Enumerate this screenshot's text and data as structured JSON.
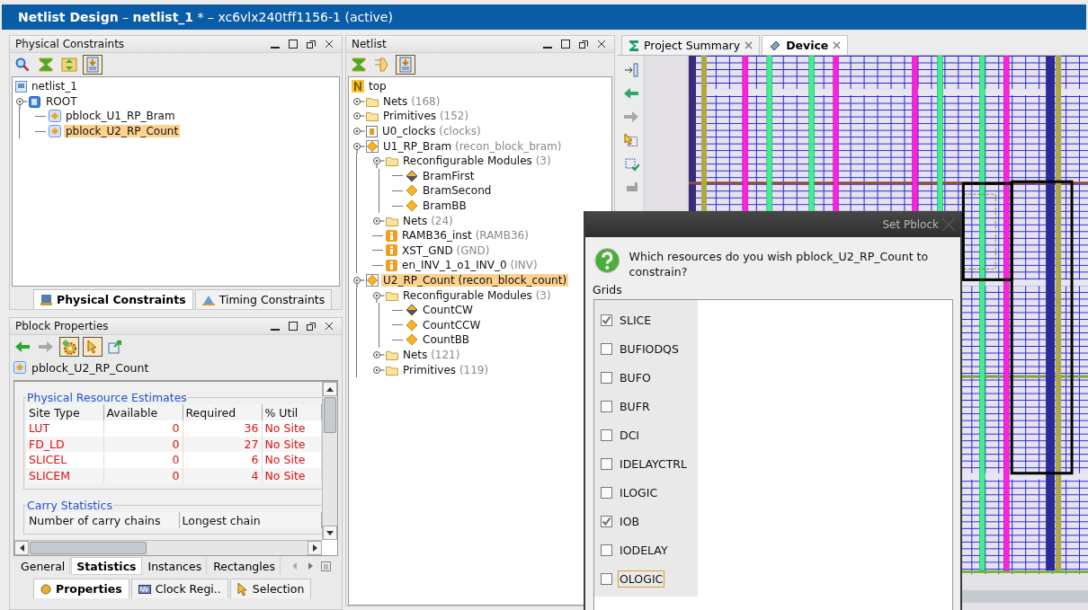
{
  "window": {
    "title": "**Netlist Design** – **netlist_1** * – xc6vlx240tff1156-1 (active)"
  },
  "physical_constraints": {
    "title": "Physical Constraints",
    "tree": [
      {
        "label": "netlist_1",
        "kind": "design",
        "selected": false
      },
      {
        "label": "ROOT",
        "kind": "root",
        "expanded": true,
        "selected": false,
        "children": [
          {
            "label": "pblock_U1_RP_Bram",
            "kind": "pblock",
            "selected": false
          },
          {
            "label": "pblock_U2_RP_Count",
            "kind": "pblock",
            "selected": true
          }
        ]
      }
    ],
    "tabs": [
      {
        "label": "Physical Constraints",
        "selected": true
      },
      {
        "label": "Timing Constraints",
        "selected": false
      }
    ]
  },
  "pblock_properties": {
    "title": "Pblock Properties",
    "object": "pblock_U2_RP_Count",
    "resource_estimates": {
      "title": "Physical Resource Estimates",
      "columns": [
        "Site Type",
        "Available",
        "Required",
        "% Util"
      ],
      "rows": [
        [
          "LUT",
          "0",
          "36",
          "No Site"
        ],
        [
          "FD_LD",
          "0",
          "27",
          "No Site"
        ],
        [
          "SLICEL",
          "0",
          "6",
          "No Site"
        ],
        [
          "SLICEM",
          "0",
          "4",
          "No Site"
        ]
      ]
    },
    "carry_statistics": {
      "title": "Carry Statistics",
      "columns": [
        "Number of carry chains",
        "Longest chain"
      ]
    },
    "tabs": [
      {
        "label": "General",
        "selected": false
      },
      {
        "label": "Statistics",
        "selected": true
      },
      {
        "label": "Instances",
        "selected": false
      },
      {
        "label": "Rectangles",
        "selected": false
      }
    ],
    "bottom_tabs": [
      {
        "label": "Properties",
        "selected": true
      },
      {
        "label": "Clock Regi..",
        "selected": false
      },
      {
        "label": "Selection",
        "selected": false
      }
    ]
  },
  "netlist": {
    "title": "Netlist",
    "tree": [
      {
        "label": "top",
        "kind": "netlist",
        "selected": false,
        "children": [
          {
            "label": "Nets",
            "detail": "(168)",
            "kind": "folder",
            "expanded": false,
            "selected": false
          },
          {
            "label": "Primitives",
            "detail": "(152)",
            "kind": "folder",
            "expanded": false,
            "selected": false
          },
          {
            "label": "U0_clocks",
            "detail": "(clocks)",
            "kind": "instance",
            "expanded": false,
            "selected": false
          },
          {
            "label": "U1_RP_Bram",
            "detail": "(recon_block_bram)",
            "kind": "module",
            "expanded": true,
            "selected": false,
            "children": [
              {
                "label": "Reconfigurable Modules",
                "detail": "(3)",
                "kind": "folder",
                "expanded": true,
                "selected": false,
                "children": [
                  {
                    "label": "BramFirst",
                    "kind": "active-variant",
                    "selected": false
                  },
                  {
                    "label": "BramSecond",
                    "kind": "variant",
                    "selected": false
                  },
                  {
                    "label": "BramBB",
                    "kind": "variant",
                    "selected": false
                  }
                ]
              },
              {
                "label": "Nets",
                "detail": "(24)",
                "kind": "folder",
                "expanded": false,
                "selected": false
              },
              {
                "label": "RAMB36_inst",
                "detail": "(RAMB36)",
                "kind": "cell",
                "selected": false
              },
              {
                "label": "XST_GND",
                "detail": "(GND)",
                "kind": "cell",
                "selected": false
              },
              {
                "label": "en_INV_1_o1_INV_0",
                "detail": "(INV)",
                "kind": "cell",
                "selected": false
              }
            ]
          },
          {
            "label": "U2_RP_Count",
            "detail": "(recon_block_count)",
            "kind": "module",
            "expanded": true,
            "selected": true,
            "children": [
              {
                "label": "Reconfigurable Modules",
                "detail": "(3)",
                "kind": "folder",
                "expanded": true,
                "selected": false,
                "children": [
                  {
                    "label": "CountCW",
                    "kind": "active-variant",
                    "selected": false
                  },
                  {
                    "label": "CountCCW",
                    "kind": "variant",
                    "selected": false
                  },
                  {
                    "label": "CountBB",
                    "kind": "variant",
                    "selected": false
                  }
                ]
              },
              {
                "label": "Nets",
                "detail": "(121)",
                "kind": "folder",
                "expanded": false,
                "selected": false
              },
              {
                "label": "Primitives",
                "detail": "(119)",
                "kind": "folder",
                "expanded": false,
                "selected": false
              }
            ]
          }
        ]
      }
    ]
  },
  "editor_tabs": [
    {
      "label": "Project Summary",
      "kind": "summary",
      "selected": false
    },
    {
      "label": "Device",
      "kind": "device",
      "selected": true
    }
  ],
  "dialog": {
    "title": "Set Pblock",
    "message": "Which resources do you wish pblock_U2_RP_Count to constrain?",
    "group_label": "Grids",
    "options": [
      {
        "label": "SLICE",
        "checked": true,
        "focused": false
      },
      {
        "label": "BUFIODQS",
        "checked": false,
        "focused": false
      },
      {
        "label": "BUFO",
        "checked": false,
        "focused": false
      },
      {
        "label": "BUFR",
        "checked": false,
        "focused": false
      },
      {
        "label": "DCI",
        "checked": false,
        "focused": false
      },
      {
        "label": "IDELAYCTRL",
        "checked": false,
        "focused": false
      },
      {
        "label": "ILOGIC",
        "checked": false,
        "focused": false
      },
      {
        "label": "IOB",
        "checked": true,
        "focused": false
      },
      {
        "label": "IODELAY",
        "checked": false,
        "focused": false
      },
      {
        "label": "OLOGIC",
        "checked": false,
        "focused": true
      }
    ]
  }
}
